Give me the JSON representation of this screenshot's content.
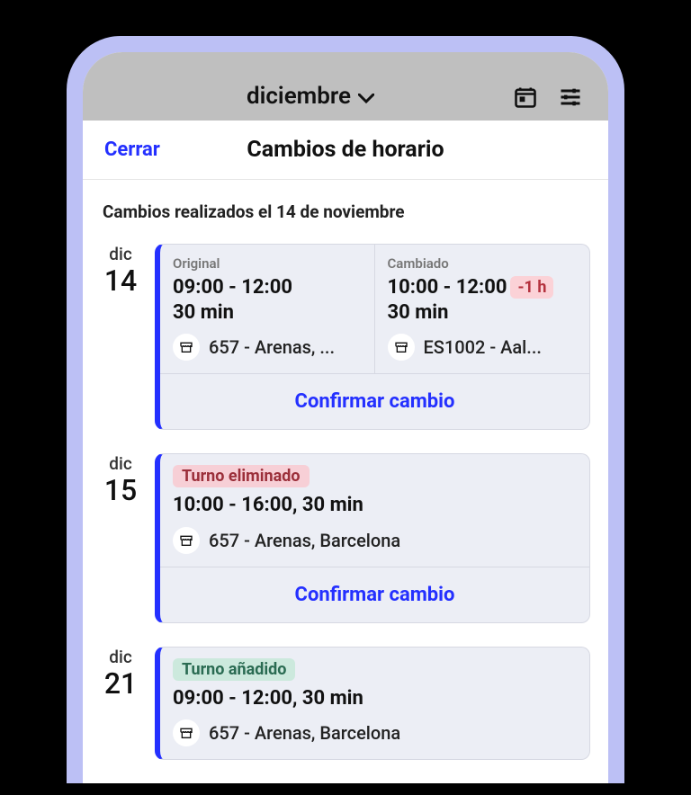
{
  "header": {
    "month": "diciembre"
  },
  "modal": {
    "close": "Cerrar",
    "title": "Cambios de horario",
    "subtitle": "Cambios realizados el 14 de noviembre"
  },
  "confirm_label": "Confirmar cambio",
  "entries": [
    {
      "month": "dic",
      "day": "14",
      "compare": {
        "original": {
          "label": "Original",
          "time": "09:00 - 12:00",
          "duration": "30 min",
          "location": "657 - Arenas, ..."
        },
        "changed": {
          "label": "Cambiado",
          "time": "10:00 - 12:00",
          "duration": "30 min",
          "delta": "-1 h",
          "location": "ES1002 - Aal..."
        }
      }
    },
    {
      "month": "dic",
      "day": "15",
      "tag": "Turno eliminado",
      "tag_color": "red",
      "time": "10:00 - 16:00, 30 min",
      "location": "657 - Arenas, Barcelona"
    },
    {
      "month": "dic",
      "day": "21",
      "tag": "Turno añadido",
      "tag_color": "green",
      "time": "09:00 - 12:00, 30 min",
      "location": "657 - Arenas, Barcelona"
    }
  ]
}
